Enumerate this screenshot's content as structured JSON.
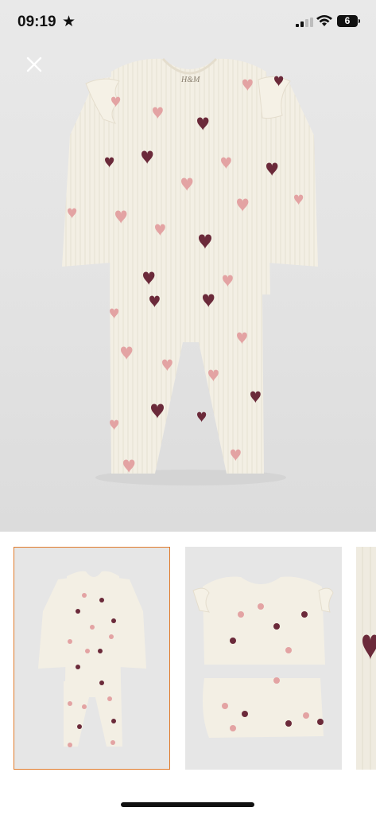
{
  "status_bar": {
    "time": "09:19",
    "battery": "6"
  },
  "icons": {
    "star": "star-icon",
    "signal": "cellular-signal-icon",
    "wifi": "wifi-icon",
    "battery": "battery-icon",
    "close": "close-icon"
  },
  "product": {
    "logo": "H&M"
  },
  "gallery": {
    "selected_index": 0,
    "thumbnail_count_visible": 3
  },
  "colors": {
    "selected_border": "#e07a2a",
    "garment": "#f3efe4",
    "heart_dark": "#6b2a3a",
    "heart_pink": "#e3a3a3"
  }
}
